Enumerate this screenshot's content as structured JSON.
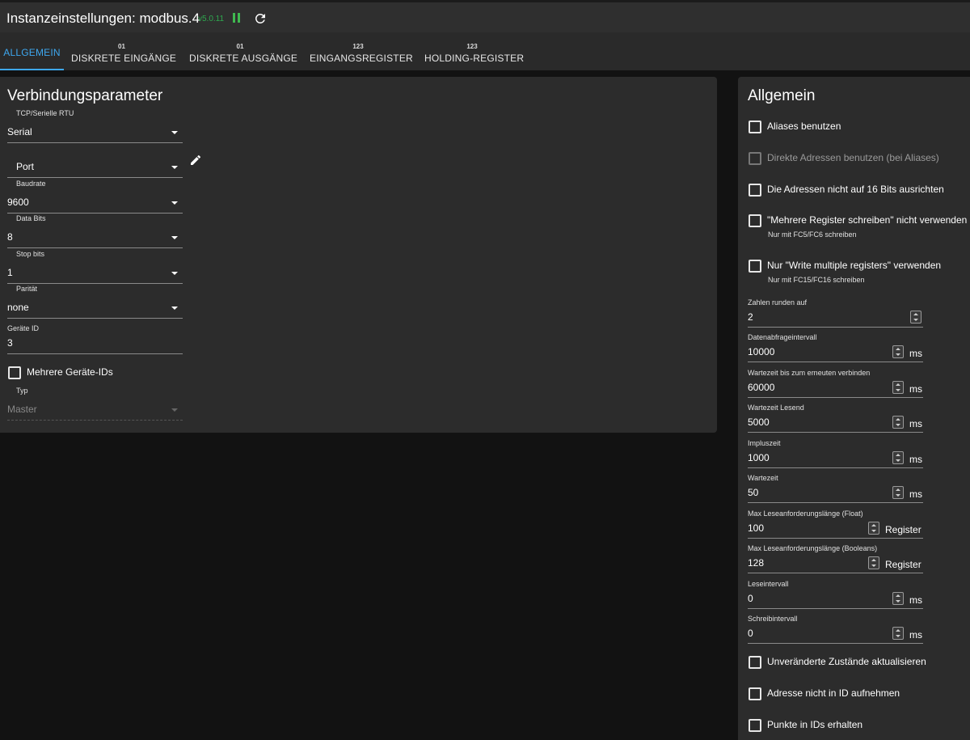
{
  "app": {
    "title": "Instanzeinstellungen: modbus.4",
    "version": "v5.0.11",
    "accent_color": "#3ea8f0",
    "status_color": "#3fb950",
    "icons": [
      "pause-icon",
      "refresh-icon",
      "pencil-icon"
    ]
  },
  "tabs": [
    {
      "badge": "",
      "label": "ALLGEMEIN",
      "active": true
    },
    {
      "badge": "01",
      "label": "DISKRETE EINGÄNGE",
      "active": false
    },
    {
      "badge": "01",
      "label": "DISKRETE AUSGÄNGE",
      "active": false
    },
    {
      "badge": "123",
      "label": "EINGANGSREGISTER",
      "active": false
    },
    {
      "badge": "123",
      "label": "HOLDING-REGISTER",
      "active": false
    }
  ],
  "connection": {
    "title": "Verbindungsparameter",
    "mode_label": "TCP/Serielle RTU",
    "mode_value": "Serial",
    "port_value": "Port",
    "baud_label": "Baudrate",
    "baud_value": "9600",
    "databits_label": "Data Bits",
    "databits_value": "8",
    "stopbits_label": "Stop bits",
    "stopbits_value": "1",
    "parity_label": "Parität",
    "parity_value": "none",
    "deviceid_label": "Geräte ID",
    "deviceid_value": "3",
    "multi_ids_label": "Mehrere Geräte-IDs",
    "type_label": "Typ",
    "type_value": "Master"
  },
  "general": {
    "title": "Allgemein",
    "use_aliases": "Aliases benutzen",
    "direct_addresses": "Direkte Adressen benutzen (bei Aliases)",
    "no_align_16": "Die Adressen nicht auf 16 Bits ausrichten",
    "no_multi_write": "\"Mehrere Register schreiben\" nicht verwenden",
    "no_multi_write_sub": "Nur mit FC5/FC6 schreiben",
    "only_write_multi": "Nur \"Write multiple registers\" verwenden",
    "only_write_multi_sub": "Nur mit FC15/FC16 schreiben",
    "round_label": "Zahlen runden auf",
    "round_value": "2",
    "poll_label": "Datenabfrageintervall",
    "poll_value": "10000",
    "poll_unit": "ms",
    "reconnect_label": "Wartezeit bis zum erneuten verbinden",
    "reconnect_value": "60000",
    "reconnect_unit": "ms",
    "readtimeout_label": "Wartezeit Lesend",
    "readtimeout_value": "5000",
    "readtimeout_unit": "ms",
    "pulse_label": "Impluszeit",
    "pulse_value": "1000",
    "pulse_unit": "ms",
    "wait_label": "Wartezeit",
    "wait_value": "50",
    "wait_unit": "ms",
    "maxfloat_label": "Max Leseanforderungslänge (Float)",
    "maxfloat_value": "100",
    "maxfloat_unit": "Register",
    "maxbool_label": "Max Leseanforderungslänge (Booleans)",
    "maxbool_value": "128",
    "maxbool_unit": "Register",
    "readint_label": "Leseintervall",
    "readint_value": "0",
    "readint_unit": "ms",
    "writeint_label": "Schreibintervall",
    "writeint_value": "0",
    "writeint_unit": "ms",
    "update_unchanged": "Unveränderte Zustände aktualisieren",
    "no_address_in_id": "Adresse nicht in ID aufnehmen",
    "keep_dots": "Punkte in IDs erhalten"
  }
}
